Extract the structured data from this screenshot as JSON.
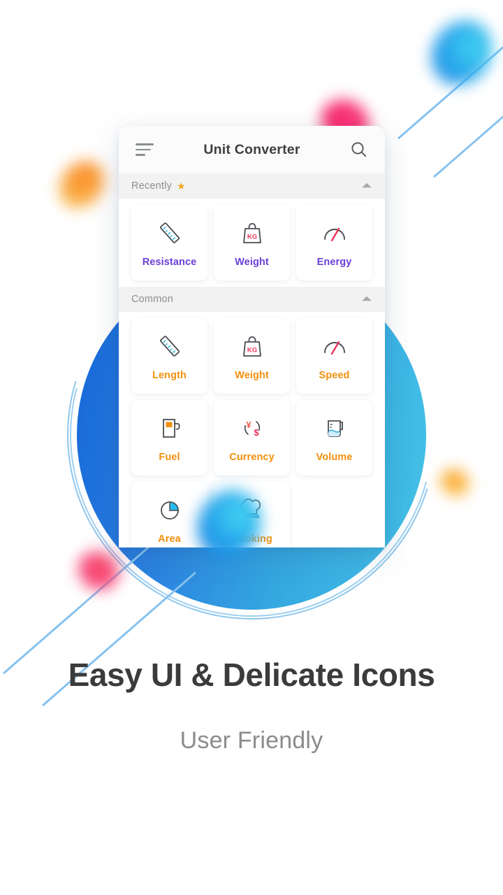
{
  "app": {
    "title": "Unit Converter",
    "menu_icon": "hamburger-menu-icon",
    "search_icon": "search-icon"
  },
  "sections": [
    {
      "id": "recently",
      "title": "Recently",
      "badge_icon": "star-icon",
      "badge_glyph": "★",
      "collapse_icon": "caret-up-icon",
      "label_color": "#6b3fd4",
      "tiles": [
        {
          "label": "Resistance",
          "icon": "ruler-icon"
        },
        {
          "label": "Weight",
          "icon": "weight-bag-icon",
          "icon_text": "KG"
        },
        {
          "label": "Energy",
          "icon": "gauge-icon"
        }
      ]
    },
    {
      "id": "common",
      "title": "Common",
      "collapse_icon": "caret-up-icon",
      "label_color": "#f2900f",
      "tiles": [
        {
          "label": "Length",
          "icon": "ruler-icon"
        },
        {
          "label": "Weight",
          "icon": "weight-bag-icon",
          "icon_text": "KG"
        },
        {
          "label": "Speed",
          "icon": "gauge-icon"
        },
        {
          "label": "Fuel",
          "icon": "fuel-pump-icon"
        },
        {
          "label": "Currency",
          "icon": "currency-exchange-icon"
        },
        {
          "label": "Volume",
          "icon": "beaker-icon"
        },
        {
          "label": "Area",
          "icon": "pie-chart-icon"
        },
        {
          "label": "Cooking",
          "icon": "chef-hat-icon"
        }
      ]
    }
  ],
  "promo": {
    "headline": "Easy UI & Delicate Icons",
    "subhead": "User Friendly"
  },
  "colors": {
    "recent_label": "#6b3fd4",
    "common_label": "#f2900f",
    "accent_blue": "#1f8fe0",
    "accent_cyan": "#45c3e8",
    "accent_pink": "#f5256b",
    "accent_orange": "#f9a23c",
    "star": "#f5a623",
    "icon_stroke": "#4a4d52",
    "icon_red": "#e8355a"
  }
}
